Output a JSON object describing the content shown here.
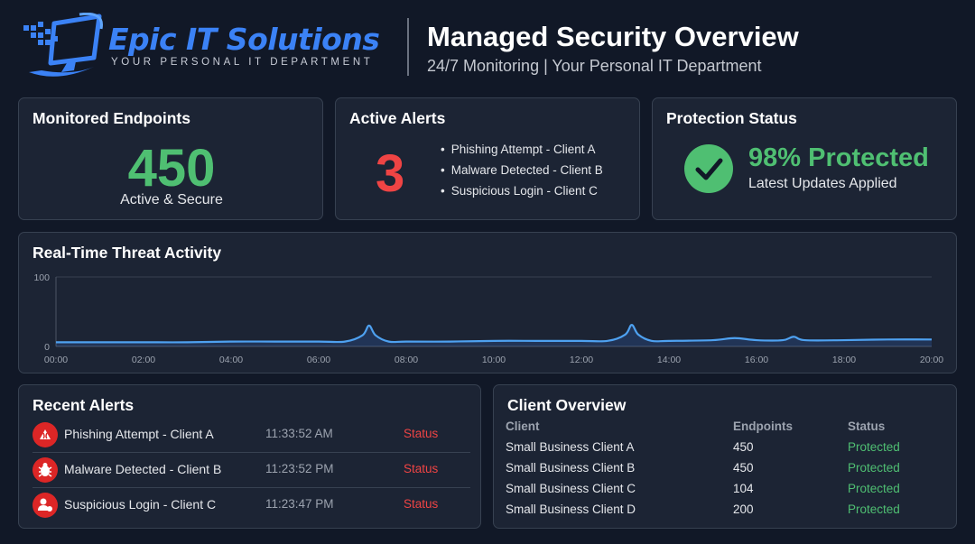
{
  "header": {
    "brand": "Epic IT Solutions",
    "tagline": "YOUR PERSONAL IT DEPARTMENT",
    "title": "Managed Security Overview",
    "subtitle": "24/7 Monitoring | Your Personal IT Department",
    "logo_icon": "monitor-logo-icon"
  },
  "colors": {
    "background": "#111827",
    "card": "#1c2434",
    "accent_blue": "#3b82f6",
    "ok_green": "#4fbf72",
    "alert_red": "#ef4444"
  },
  "endpoints": {
    "title": "Monitored Endpoints",
    "count": "450",
    "subtitle": "Active & Secure"
  },
  "alerts": {
    "title": "Active Alerts",
    "count": "3",
    "items": [
      "Phishing Attempt - Client A",
      "Malware Detected - Client B",
      "Suspicious Login - Client C"
    ]
  },
  "protection": {
    "title": "Protection Status",
    "value": "98% Protected",
    "subtitle": "Latest Updates Applied",
    "icon": "check-circle-icon"
  },
  "threat": {
    "title": "Real-Time Threat Activity"
  },
  "chart_data": {
    "type": "area",
    "title": "Real-Time Threat Activity",
    "xlabel": "",
    "ylabel": "",
    "x_ticks": [
      "00:00",
      "02:00",
      "04:00",
      "06:00",
      "08:00",
      "10:00",
      "12:00",
      "14:00",
      "16:00",
      "18:00",
      "20:00"
    ],
    "y_ticks": [
      "100",
      "0"
    ],
    "xlim": [
      0,
      20
    ],
    "ylim": [
      0,
      100
    ],
    "grid": false,
    "series": [
      {
        "x": [
          0,
          1,
          2,
          3,
          4,
          5,
          6,
          6.6,
          7.0,
          7.15,
          7.3,
          7.6,
          8,
          9,
          10,
          11,
          12,
          12.6,
          13.0,
          13.15,
          13.3,
          13.6,
          14,
          15,
          15.5,
          16,
          16.6,
          16.85,
          17.1,
          18,
          19,
          20
        ],
        "y": [
          6,
          6,
          6,
          6,
          7,
          7,
          7,
          7,
          16,
          30,
          16,
          7,
          7,
          7,
          8,
          8,
          8,
          8,
          17,
          31,
          17,
          8,
          8,
          9,
          12,
          9,
          9,
          14,
          9,
          9,
          10,
          10
        ]
      }
    ]
  },
  "recent": {
    "title": "Recent Alerts",
    "rows": [
      {
        "label": "Phishing Attempt - Client A",
        "time": "11:33:52 AM",
        "status": "Status",
        "icon": "phishing-hook-icon"
      },
      {
        "label": "Malware Detected - Client B",
        "time": "11:23:52 PM",
        "status": "Status",
        "icon": "malware-bug-icon"
      },
      {
        "label": "Suspicious Login - Client C",
        "time": "11:23:47 PM",
        "status": "Status",
        "icon": "user-login-icon"
      }
    ]
  },
  "client": {
    "title": "Client Overview",
    "columns": [
      "Client",
      "Endpoints",
      "Status"
    ],
    "rows": [
      {
        "client": "Small Business Client A",
        "endpoints": "450",
        "status": "Protected"
      },
      {
        "client": "Small Business Client B",
        "endpoints": "450",
        "status": "Protected"
      },
      {
        "client": "Small Business Client C",
        "endpoints": "104",
        "status": "Protected"
      },
      {
        "client": "Small Business Client D",
        "endpoints": "200",
        "status": "Protected"
      }
    ]
  }
}
